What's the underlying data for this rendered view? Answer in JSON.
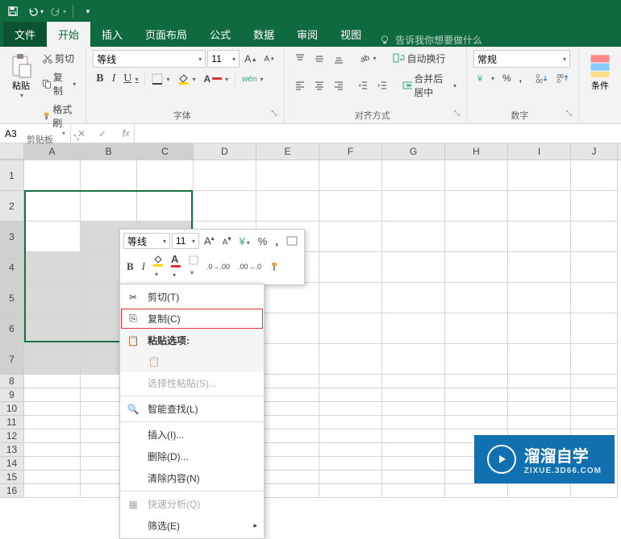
{
  "tabs": {
    "file": "文件",
    "home": "开始",
    "insert": "插入",
    "layout": "页面布局",
    "formulas": "公式",
    "data": "数据",
    "review": "审阅",
    "view": "视图"
  },
  "tell_me": "告诉我你想要做什么",
  "clipboard": {
    "paste": "粘贴",
    "cut": "剪切",
    "copy": "复制",
    "format_painter": "格式刷",
    "group": "剪贴板"
  },
  "font": {
    "name": "等线",
    "size": "11",
    "group": "字体",
    "wen": "wén"
  },
  "alignment": {
    "wrap": "自动换行",
    "merge": "合并后居中",
    "group": "对齐方式"
  },
  "number": {
    "format": "常规",
    "percent": "%",
    "comma": ",",
    "group": "数字"
  },
  "styles": {
    "cond": "条件"
  },
  "namebox": "A3",
  "columns": [
    "A",
    "B",
    "C",
    "D",
    "E",
    "F",
    "G",
    "H",
    "I",
    "J"
  ],
  "rows_tall": [
    1,
    2,
    3,
    4,
    5,
    6,
    7
  ],
  "rows_norm": [
    8,
    9,
    10,
    11,
    12,
    13,
    14,
    15,
    16
  ],
  "mini": {
    "font": "等线",
    "size": "11"
  },
  "ctx": {
    "cut": "剪切(T)",
    "copy": "复制(C)",
    "paste_options": "粘贴选项:",
    "paste_special": "选择性粘贴(S)...",
    "smart_lookup": "智能查找(L)",
    "insert": "插入(I)...",
    "delete": "删除(D)...",
    "clear": "清除内容(N)",
    "quick_analysis": "快速分析(Q)",
    "filter": "筛选(E)"
  },
  "watermark": {
    "text": "溜溜自学",
    "sub": "ZIXUE.3D66.COM"
  }
}
